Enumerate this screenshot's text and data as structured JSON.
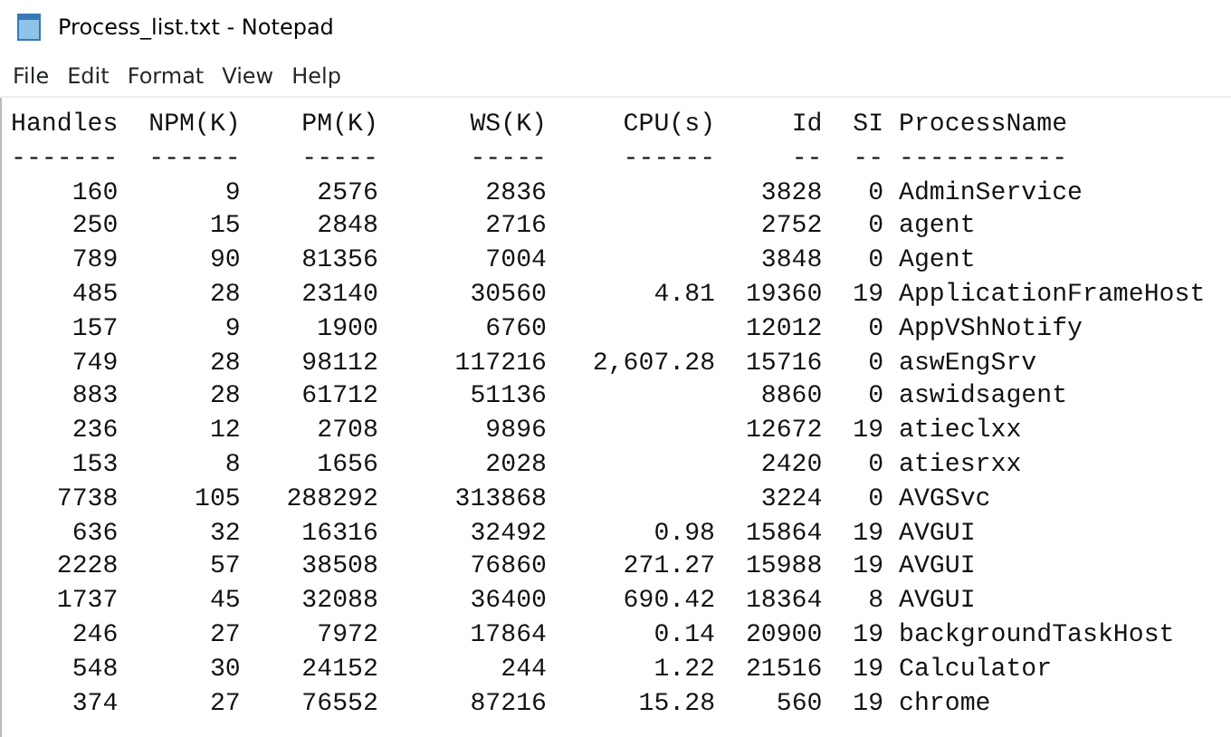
{
  "window": {
    "title": "Process_list.txt - Notepad"
  },
  "menu": [
    "File",
    "Edit",
    "Format",
    "View",
    "Help"
  ],
  "table": {
    "columns": [
      {
        "label": "Handles",
        "rule": "-------"
      },
      {
        "label": "NPM(K)",
        "rule": "------"
      },
      {
        "label": "PM(K)",
        "rule": "-----"
      },
      {
        "label": "WS(K)",
        "rule": "-----"
      },
      {
        "label": "CPU(s)",
        "rule": "------"
      },
      {
        "label": "Id",
        "rule": "--"
      },
      {
        "label": "SI",
        "rule": "--"
      },
      {
        "label": "ProcessName",
        "rule": "-----------"
      }
    ],
    "rows": [
      [
        "160",
        "9",
        "2576",
        "2836",
        null,
        "3828",
        "0",
        "AdminService"
      ],
      [
        "250",
        "15",
        "2848",
        "2716",
        null,
        "2752",
        "0",
        "agent"
      ],
      [
        "789",
        "90",
        "81356",
        "7004",
        null,
        "3848",
        "0",
        "Agent"
      ],
      [
        "485",
        "28",
        "23140",
        "30560",
        "4.81",
        "19360",
        "19",
        "ApplicationFrameHost"
      ],
      [
        "157",
        "9",
        "1900",
        "6760",
        null,
        "12012",
        "0",
        "AppVShNotify"
      ],
      [
        "749",
        "28",
        "98112",
        "117216",
        "2,607.28",
        "15716",
        "0",
        "aswEngSrv"
      ],
      [
        "883",
        "28",
        "61712",
        "51136",
        null,
        "8860",
        "0",
        "aswidsagent"
      ],
      [
        "236",
        "12",
        "2708",
        "9896",
        null,
        "12672",
        "19",
        "atieclxx"
      ],
      [
        "153",
        "8",
        "1656",
        "2028",
        null,
        "2420",
        "0",
        "atiesrxx"
      ],
      [
        "7738",
        "105",
        "288292",
        "313868",
        null,
        "3224",
        "0",
        "AVGSvc"
      ],
      [
        "636",
        "32",
        "16316",
        "32492",
        "0.98",
        "15864",
        "19",
        "AVGUI"
      ],
      [
        "2228",
        "57",
        "38508",
        "76860",
        "271.27",
        "15988",
        "19",
        "AVGUI"
      ],
      [
        "1737",
        "45",
        "32088",
        "36400",
        "690.42",
        "18364",
        "8",
        "AVGUI"
      ],
      [
        "246",
        "27",
        "7972",
        "17864",
        "0.14",
        "20900",
        "19",
        "backgroundTaskHost"
      ],
      [
        "548",
        "30",
        "24152",
        "244",
        "1.22",
        "21516",
        "19",
        "Calculator"
      ],
      [
        "374",
        "27",
        "76552",
        "87216",
        "15.28",
        "560",
        "19",
        "chrome"
      ]
    ]
  }
}
